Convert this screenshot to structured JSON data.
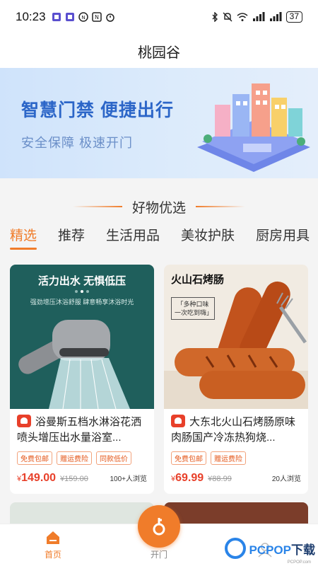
{
  "status_bar": {
    "time": "10:23",
    "battery": "37"
  },
  "header": {
    "title": "桃园谷"
  },
  "banner": {
    "title": "智慧门禁  便捷出行",
    "subtitle": "安全保障  极速开门"
  },
  "section": {
    "title": "好物优选"
  },
  "tabs": [
    {
      "label": "精选",
      "active": true
    },
    {
      "label": "推荐",
      "active": false
    },
    {
      "label": "生活用品",
      "active": false
    },
    {
      "label": "美妆护肤",
      "active": false
    },
    {
      "label": "厨房用具",
      "active": false
    }
  ],
  "products": [
    {
      "image_caption": "活力出水 无惧低压",
      "image_subcaption": "强劲增压沐浴舒服 肆意畅享沐浴时光",
      "title": "浴曼斯五档水淋浴花洒喷头增压出水量浴室...",
      "tags": [
        "免费包邮",
        "赠运费险",
        "同款低价"
      ],
      "price_symbol": "¥",
      "price": "149.00",
      "original_price": "¥159.00",
      "views": "100+人浏览"
    },
    {
      "image_caption": "火山石烤肠",
      "image_note": "「多种口味 一次吃到嗨」",
      "title": "大东北火山石烤肠原味肉肠国产冷冻热狗烧...",
      "tags": [
        "免费包邮",
        "赠运费险"
      ],
      "price_symbol": "¥",
      "price": "69.99",
      "original_price": "¥88.99",
      "views": "20人浏览"
    }
  ],
  "bottom_nav": {
    "home": "首页",
    "open": "开门",
    "mine": ""
  },
  "watermark": {
    "brand": "PCPOP",
    "suffix": "下载",
    "small": "PCPOP.com"
  },
  "colors": {
    "accent": "#f07c2a",
    "price": "#e8402a",
    "banner_title": "#2c66c8"
  }
}
